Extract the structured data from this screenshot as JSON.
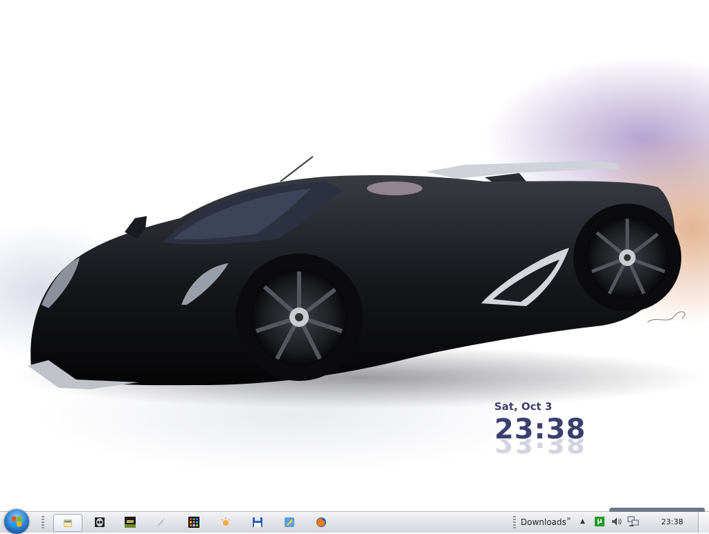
{
  "desktop": {
    "clock": {
      "date": "Sat, Oct 3",
      "time": "23:38"
    }
  },
  "taskbar": {
    "start_icon": "windows-orb-icon",
    "pinned": [
      {
        "icon": "explorer-icon"
      },
      {
        "icon": "alien-icon"
      },
      {
        "icon": "mw-game-icon"
      },
      {
        "icon": "feather-icon"
      },
      {
        "icon": "color-grid-icon"
      },
      {
        "icon": "sun-icon"
      },
      {
        "icon": "floppy-icon"
      },
      {
        "icon": "pencil-app-icon"
      },
      {
        "icon": "firefox-icon"
      }
    ],
    "toolbar": {
      "label": "Downloads",
      "chevron": "»"
    },
    "tray": {
      "up_arrow": "▲",
      "utorrent_label": "µ",
      "time": "23:38"
    }
  }
}
